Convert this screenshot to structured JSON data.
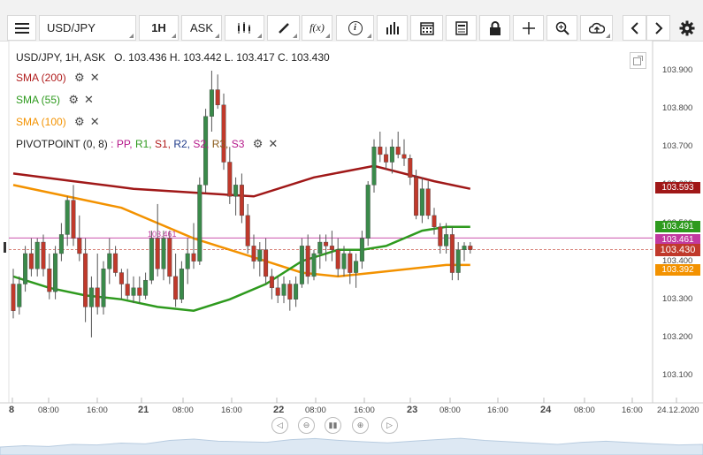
{
  "toolbar": {
    "symbol": "USD/JPY",
    "timeframe": "1H",
    "price_type": "ASK",
    "fx_label": "f(x)",
    "info_label": "i"
  },
  "header": {
    "ohlc": "USD/JPY, 1H, ASK   O. 103.436 H. 103.442 L. 103.417 C. 103.430"
  },
  "indicators": [
    {
      "label": "SMA (200)",
      "color": "#b01c1c"
    },
    {
      "label": "SMA (55)",
      "color": "#2e9a1e"
    },
    {
      "label": "SMA (100)",
      "color": "#f39200"
    }
  ],
  "pivot": {
    "label": "PIVOTPOINT (0, 8)",
    "parts": [
      {
        "text": ": PP,",
        "color": "#b5188a"
      },
      {
        "text": " R1,",
        "color": "#2e9a1e"
      },
      {
        "text": " S1,",
        "color": "#b01c1c"
      },
      {
        "text": " R2,",
        "color": "#1f3b8a"
      },
      {
        "text": " S2,",
        "color": "#b5188a"
      },
      {
        "text": " R3,",
        "color": "#8a5a1a"
      },
      {
        "text": " S3",
        "color": "#b5188a"
      }
    ]
  },
  "pp_line_label": "103.461",
  "price_axis": [
    "103.900",
    "103.800",
    "103.700",
    "103.600",
    "103.500",
    "103.400",
    "103.300",
    "103.200",
    "103.100"
  ],
  "price_tags": [
    {
      "value": "103.593",
      "color": "#a01818"
    },
    {
      "value": "103.491",
      "color": "#2e9a1e"
    },
    {
      "value": "103.461",
      "color": "#c23aa0"
    },
    {
      "value": "103.430",
      "color": "#c0392b"
    },
    {
      "value": "103.392",
      "color": "#f39200"
    }
  ],
  "time_axis": [
    {
      "label": "8",
      "bold": true
    },
    {
      "label": "08:00",
      "bold": false
    },
    {
      "label": "16:00",
      "bold": false
    },
    {
      "label": "21",
      "bold": true
    },
    {
      "label": "08:00",
      "bold": false
    },
    {
      "label": "16:00",
      "bold": false
    },
    {
      "label": "22",
      "bold": true
    },
    {
      "label": "08:00",
      "bold": false
    },
    {
      "label": "16:00",
      "bold": false
    },
    {
      "label": "23",
      "bold": true
    },
    {
      "label": "08:00",
      "bold": false
    },
    {
      "label": "16:00",
      "bold": false
    },
    {
      "label": "24",
      "bold": true
    },
    {
      "label": "08:00",
      "bold": false
    },
    {
      "label": "16:00",
      "bold": false
    },
    {
      "label": "24.12.2020",
      "bold": false
    }
  ],
  "colors": {
    "bull": "#3a8a4a",
    "bear": "#c0392b",
    "sma200": "#a01818",
    "sma55": "#2e9a1e",
    "sma100": "#f39200",
    "pp": "#c23aa0"
  },
  "chart_data": {
    "type": "candlestick",
    "symbol": "USD/JPY",
    "interval": "1H",
    "ylim": [
      103.05,
      103.95
    ],
    "candles": [
      [
        103.34,
        103.38,
        103.25,
        103.27
      ],
      [
        103.28,
        103.36,
        103.26,
        103.34
      ],
      [
        103.34,
        103.44,
        103.32,
        103.42
      ],
      [
        103.42,
        103.46,
        103.36,
        103.38
      ],
      [
        103.38,
        103.46,
        103.36,
        103.45
      ],
      [
        103.45,
        103.47,
        103.36,
        103.38
      ],
      [
        103.38,
        103.42,
        103.3,
        103.32
      ],
      [
        103.32,
        103.44,
        103.3,
        103.42
      ],
      [
        103.42,
        103.5,
        103.4,
        103.47
      ],
      [
        103.47,
        103.57,
        103.44,
        103.56
      ],
      [
        103.56,
        103.6,
        103.44,
        103.46
      ],
      [
        103.46,
        103.52,
        103.4,
        103.42
      ],
      [
        103.42,
        103.46,
        103.24,
        103.28
      ],
      [
        103.28,
        103.36,
        103.2,
        103.33
      ],
      [
        103.33,
        103.42,
        103.26,
        103.28
      ],
      [
        103.28,
        103.4,
        103.26,
        103.38
      ],
      [
        103.38,
        103.46,
        103.34,
        103.42
      ],
      [
        103.42,
        103.44,
        103.36,
        103.37
      ],
      [
        103.37,
        103.38,
        103.3,
        103.34
      ],
      [
        103.34,
        103.38,
        103.3,
        103.31
      ],
      [
        103.31,
        103.36,
        103.29,
        103.33
      ],
      [
        103.33,
        103.36,
        103.29,
        103.31
      ],
      [
        103.31,
        103.37,
        103.3,
        103.35
      ],
      [
        103.35,
        103.48,
        103.34,
        103.46
      ],
      [
        103.46,
        103.55,
        103.36,
        103.38
      ],
      [
        103.38,
        103.48,
        103.35,
        103.46
      ],
      [
        103.46,
        103.48,
        103.34,
        103.36
      ],
      [
        103.36,
        103.42,
        103.28,
        103.3
      ],
      [
        103.3,
        103.4,
        103.29,
        103.38
      ],
      [
        103.38,
        103.46,
        103.34,
        103.42
      ],
      [
        103.42,
        103.5,
        103.38,
        103.4
      ],
      [
        103.4,
        103.62,
        103.39,
        103.6
      ],
      [
        103.6,
        103.8,
        103.58,
        103.78
      ],
      [
        103.78,
        103.9,
        103.74,
        103.85
      ],
      [
        103.85,
        103.89,
        103.8,
        103.81
      ],
      [
        103.81,
        103.84,
        103.64,
        103.66
      ],
      [
        103.66,
        103.7,
        103.55,
        103.57
      ],
      [
        103.57,
        103.62,
        103.52,
        103.6
      ],
      [
        103.6,
        103.63,
        103.5,
        103.52
      ],
      [
        103.52,
        103.55,
        103.42,
        103.44
      ],
      [
        103.44,
        103.47,
        103.38,
        103.4
      ],
      [
        103.4,
        103.45,
        103.36,
        103.43
      ],
      [
        103.43,
        103.46,
        103.34,
        103.36
      ],
      [
        103.36,
        103.38,
        103.3,
        103.33
      ],
      [
        103.33,
        103.36,
        103.29,
        103.31
      ],
      [
        103.31,
        103.36,
        103.29,
        103.34
      ],
      [
        103.34,
        103.35,
        103.27,
        103.3
      ],
      [
        103.3,
        103.36,
        103.28,
        103.34
      ],
      [
        103.34,
        103.46,
        103.33,
        103.44
      ],
      [
        103.44,
        103.47,
        103.34,
        103.36
      ],
      [
        103.36,
        103.43,
        103.35,
        103.42
      ],
      [
        103.42,
        103.47,
        103.38,
        103.45
      ],
      [
        103.45,
        103.47,
        103.4,
        103.44
      ],
      [
        103.44,
        103.48,
        103.4,
        103.43
      ],
      [
        103.43,
        103.46,
        103.36,
        103.38
      ],
      [
        103.38,
        103.44,
        103.36,
        103.42
      ],
      [
        103.42,
        103.43,
        103.34,
        103.37
      ],
      [
        103.37,
        103.42,
        103.33,
        103.4
      ],
      [
        103.4,
        103.48,
        103.38,
        103.46
      ],
      [
        103.46,
        103.61,
        103.44,
        103.6
      ],
      [
        103.6,
        103.72,
        103.58,
        103.7
      ],
      [
        103.7,
        103.74,
        103.66,
        103.68
      ],
      [
        103.68,
        103.7,
        103.64,
        103.66
      ],
      [
        103.66,
        103.72,
        103.63,
        103.7
      ],
      [
        103.7,
        103.74,
        103.67,
        103.68
      ],
      [
        103.68,
        103.72,
        103.65,
        103.67
      ],
      [
        103.67,
        103.68,
        103.6,
        103.62
      ],
      [
        103.62,
        103.64,
        103.51,
        103.52
      ],
      [
        103.52,
        103.62,
        103.5,
        103.59
      ],
      [
        103.59,
        103.61,
        103.51,
        103.52
      ],
      [
        103.52,
        103.54,
        103.47,
        103.49
      ],
      [
        103.49,
        103.5,
        103.42,
        103.44
      ],
      [
        103.44,
        103.5,
        103.42,
        103.47
      ],
      [
        103.47,
        103.49,
        103.35,
        103.37
      ],
      [
        103.37,
        103.45,
        103.35,
        103.43
      ],
      [
        103.43,
        103.45,
        103.4,
        103.44
      ],
      [
        103.44,
        103.45,
        103.42,
        103.43
      ]
    ],
    "sma200": [
      [
        0,
        103.63
      ],
      [
        10,
        103.61
      ],
      [
        20,
        103.59
      ],
      [
        30,
        103.58
      ],
      [
        40,
        103.57
      ],
      [
        50,
        103.62
      ],
      [
        60,
        103.65
      ],
      [
        70,
        103.61
      ],
      [
        76,
        103.59
      ]
    ],
    "sma55": [
      [
        0,
        103.36
      ],
      [
        6,
        103.33
      ],
      [
        12,
        103.31
      ],
      [
        18,
        103.3
      ],
      [
        24,
        103.28
      ],
      [
        30,
        103.27
      ],
      [
        36,
        103.3
      ],
      [
        42,
        103.34
      ],
      [
        48,
        103.4
      ],
      [
        54,
        103.43
      ],
      [
        58,
        103.43
      ],
      [
        62,
        103.44
      ],
      [
        68,
        103.48
      ],
      [
        72,
        103.49
      ],
      [
        76,
        103.49
      ]
    ],
    "sma100": [
      [
        0,
        103.6
      ],
      [
        6,
        103.58
      ],
      [
        12,
        103.56
      ],
      [
        18,
        103.54
      ],
      [
        24,
        103.5
      ],
      [
        30,
        103.46
      ],
      [
        36,
        103.43
      ],
      [
        42,
        103.4
      ],
      [
        48,
        103.37
      ],
      [
        54,
        103.36
      ],
      [
        60,
        103.37
      ],
      [
        66,
        103.38
      ],
      [
        72,
        103.39
      ],
      [
        76,
        103.39
      ]
    ],
    "pivot_pp": 103.461,
    "last_close": 103.43
  },
  "navigator_profile": [
    0.3,
    0.35,
    0.32,
    0.4,
    0.38,
    0.45,
    0.42,
    0.55,
    0.6,
    0.52,
    0.5,
    0.48,
    0.58,
    0.62,
    0.55,
    0.5,
    0.46,
    0.52,
    0.58,
    0.63,
    0.55,
    0.5,
    0.45,
    0.4,
    0.48,
    0.52,
    0.47,
    0.42,
    0.38,
    0.4
  ]
}
